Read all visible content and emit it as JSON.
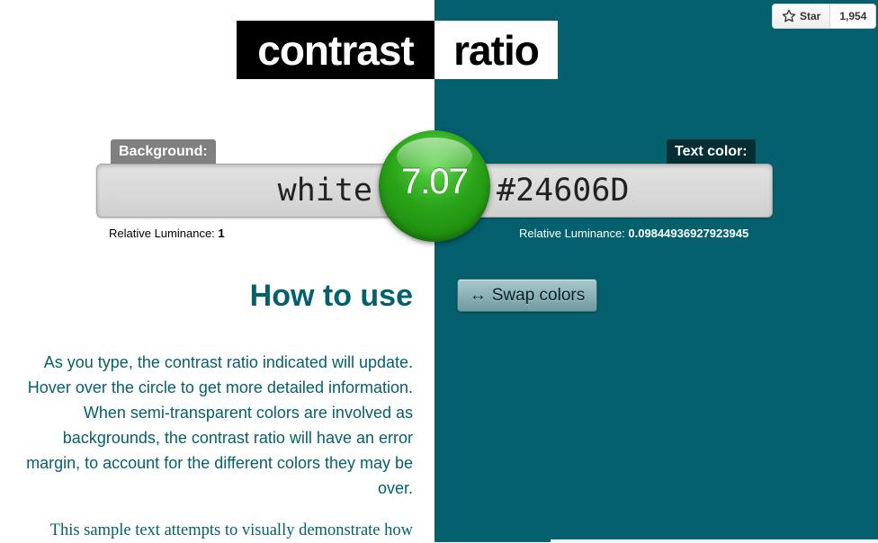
{
  "logo": {
    "part1": "contrast",
    "part2": "ratio"
  },
  "github": {
    "star_label": "Star",
    "star_count": "1,954"
  },
  "background": {
    "label": "Background:",
    "value": "white",
    "luminance_label": "Relative Luminance:",
    "luminance_value": "1"
  },
  "text_color": {
    "label": "Text color:",
    "value": "#24606D",
    "luminance_label": "Relative Luminance:",
    "luminance_value": "0.09844936927923945"
  },
  "ratio": {
    "value": "7.07"
  },
  "swap": {
    "arrow": "↔",
    "label": "Swap colors"
  },
  "how_to_use": {
    "title": "How to use",
    "paragraph": "As you type, the contrast ratio indicated will update. Hover over the circle to get more detailed information. When semi-transparent colors are involved as backgrounds, the contrast ratio will have an error margin, to account for the different colors they may be over.",
    "sample": "This sample text attempts to visually demonstrate how"
  },
  "colors": {
    "teal": "#04606d",
    "ratio_green": "#2aa418",
    "black": "#000000",
    "white": "#ffffff"
  }
}
